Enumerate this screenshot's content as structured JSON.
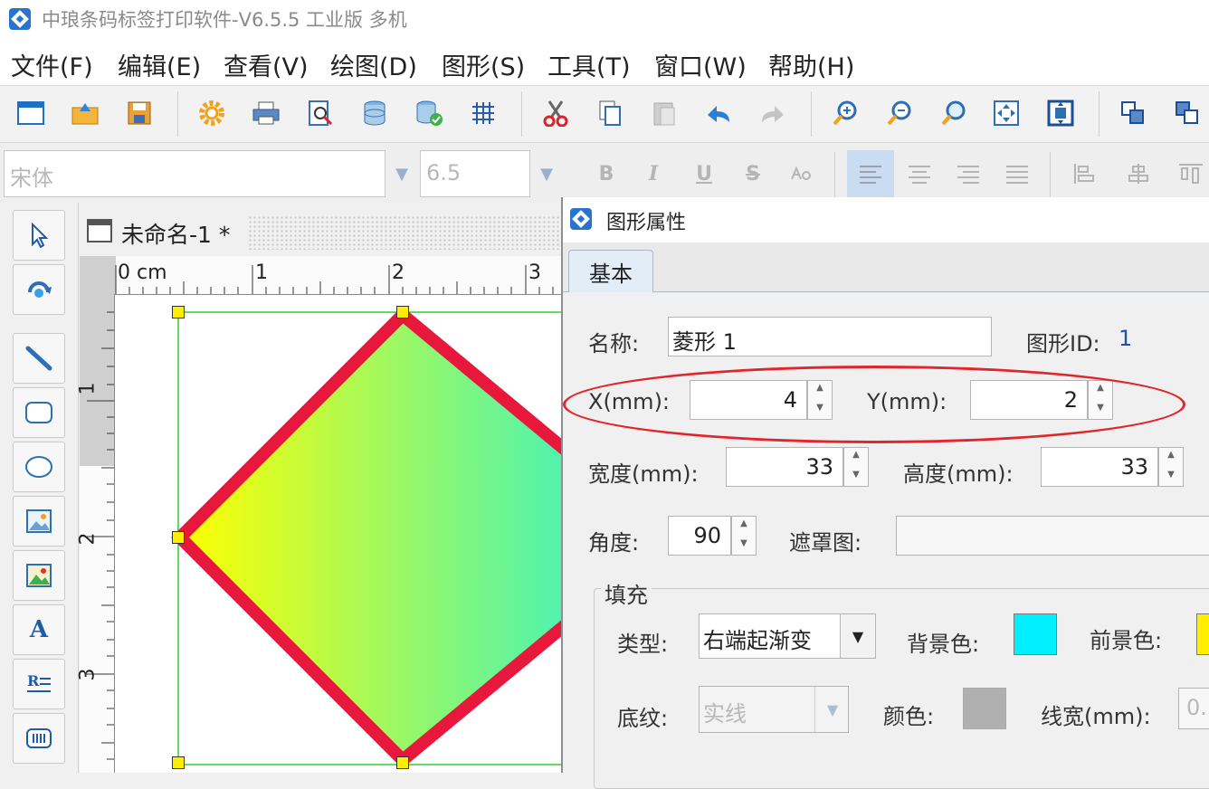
{
  "window": {
    "title": "中琅条码标签打印软件-V6.5.5 工业版 多机"
  },
  "menu": [
    "文件(F)",
    "编辑(E)",
    "查看(V)",
    "绘图(D)",
    "图形(S)",
    "工具(T)",
    "窗口(W)",
    "帮助(H)"
  ],
  "toolbar_icons": [
    "new-icon",
    "open-icon",
    "save-icon",
    "settings-icon",
    "print-icon",
    "print-preview-icon",
    "database-icon",
    "database-connect-icon",
    "grid-icon",
    "cut-icon",
    "copy-icon",
    "paste-icon",
    "undo-icon",
    "redo-icon",
    "zoom-in-icon",
    "zoom-out-icon",
    "zoom-icon",
    "fit-page-icon",
    "fit-selection-icon",
    "bring-front-icon",
    "send-back-icon"
  ],
  "format": {
    "font_name": "宋体",
    "font_size": "6.5",
    "bold": "B",
    "italic": "I",
    "underline": "U",
    "strike": "S"
  },
  "left_tools": [
    "select-icon",
    "rotate-icon",
    "line-icon",
    "rounded-rect-icon",
    "ellipse-icon",
    "image-icon",
    "image-embed-icon",
    "text-icon",
    "rich-text-icon",
    "barcode-icon"
  ],
  "document": {
    "tab_title": "未命名-1 *",
    "ruler_h": [
      "0 cm",
      "1",
      "2",
      "3"
    ],
    "ruler_v": [
      "1",
      "2",
      "3"
    ]
  },
  "shape": {
    "border_color": "#e8173c",
    "grad_start": "#ffff00",
    "grad_end": "#1fefe0"
  },
  "dialog": {
    "title": "图形属性",
    "tab_basic": "基本",
    "name_label": "名称:",
    "name_value": "菱形 1",
    "id_label": "图形ID:",
    "id_value": "1",
    "x_label": "X(mm):",
    "x_value": "4",
    "y_label": "Y(mm):",
    "y_value": "2",
    "width_label": "宽度(mm):",
    "width_value": "33",
    "height_label": "高度(mm):",
    "height_value": "33",
    "angle_label": "角度:",
    "angle_value": "90",
    "mask_label": "遮罩图:",
    "fill": {
      "group_label": "填充",
      "type_label": "类型:",
      "type_value": "右端起渐变",
      "bg_label": "背景色:",
      "bg_color": "#00f0ff",
      "fg_label": "前景色:",
      "fg_color": "#ffee00",
      "pattern_label": "底纹:",
      "pattern_value": "实线",
      "color_label": "颜色:",
      "pattern_color": "#b0b0b0",
      "linewidth_label": "线宽(mm):",
      "linewidth_value": "0."
    }
  }
}
